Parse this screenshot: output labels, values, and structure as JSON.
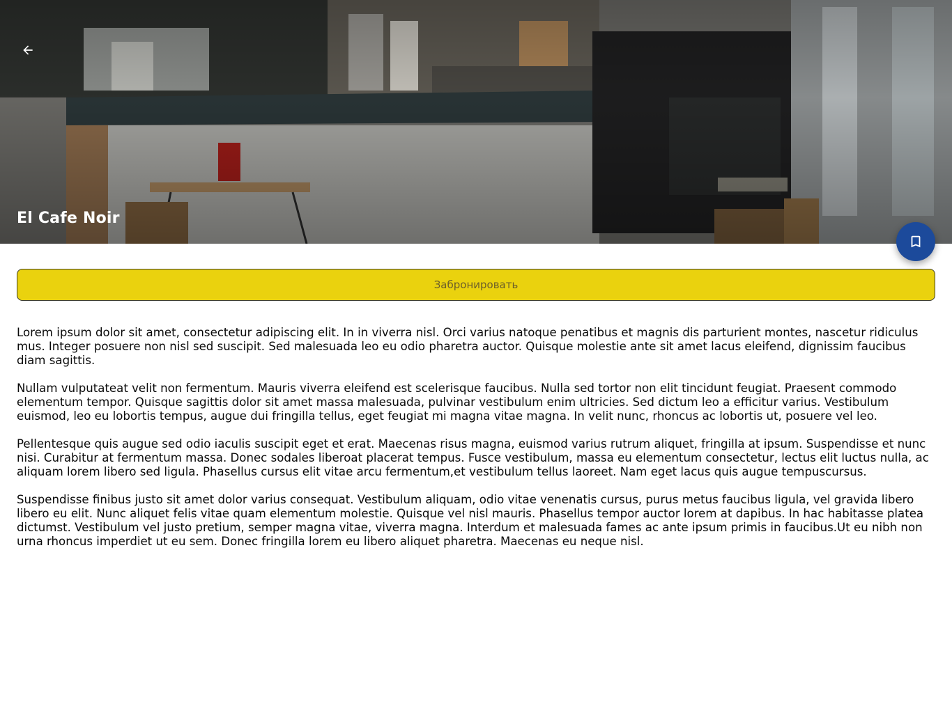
{
  "header": {
    "back_icon": "arrow-left-icon",
    "title": "El Cafe Noir",
    "bookmark_icon": "bookmark-icon"
  },
  "colors": {
    "accent_button": "#ead20e",
    "fab": "#1c4a9b"
  },
  "actions": {
    "book_label": "Забронировать"
  },
  "description": {
    "paragraphs": [
      "Lorem ipsum dolor sit amet, consectetur adipiscing elit. In in viverra nisl. Orci varius natoque penatibus et magnis dis parturient montes, nascetur ridiculus mus. Integer posuere non nisl sed suscipit. Sed malesuada leo eu odio pharetra auctor. Quisque molestie ante sit amet lacus eleifend, dignissim faucibus diam sagittis.",
      "Nullam vulputateat velit non fermentum. Mauris viverra eleifend est scelerisque faucibus. Nulla sed tortor non elit tincidunt feugiat. Praesent commodo elementum tempor. Quisque sagittis dolor sit amet massa malesuada, pulvinar vestibulum enim ultricies. Sed dictum leo a efficitur varius. Vestibulum euismod, leo eu lobortis tempus, augue dui fringilla tellus, eget feugiat mi magna vitae magna. In velit nunc, rhoncus ac lobortis ut, posuere vel leo.",
      "Pellentesque quis augue sed odio iaculis suscipit eget et erat. Maecenas risus magna, euismod varius rutrum aliquet, fringilla at ipsum. Suspendisse et nunc nisi. Curabitur at fermentum massa. Donec sodales liberoat placerat tempus. Fusce vestibulum, massa eu elementum consectetur, lectus elit luctus nulla, ac aliquam lorem libero sed ligula. Phasellus cursus elit vitae arcu fermentum,et vestibulum tellus laoreet. Nam eget lacus quis augue tempuscursus.",
      "Suspendisse finibus justo sit amet dolor varius consequat. Vestibulum aliquam, odio vitae venenatis cursus, purus metus faucibus ligula, vel gravida libero libero eu elit. Nunc aliquet felis vitae quam elementum molestie. Quisque vel nisl mauris. Phasellus tempor auctor lorem at dapibus. In hac habitasse platea dictumst. Vestibulum vel justo pretium, semper magna vitae, viverra magna. Interdum et malesuada fames ac ante ipsum primis in faucibus.Ut eu nibh non urna rhoncus imperdiet ut eu sem. Donec fringilla lorem eu libero aliquet pharetra. Maecenas eu neque nisl."
    ]
  }
}
